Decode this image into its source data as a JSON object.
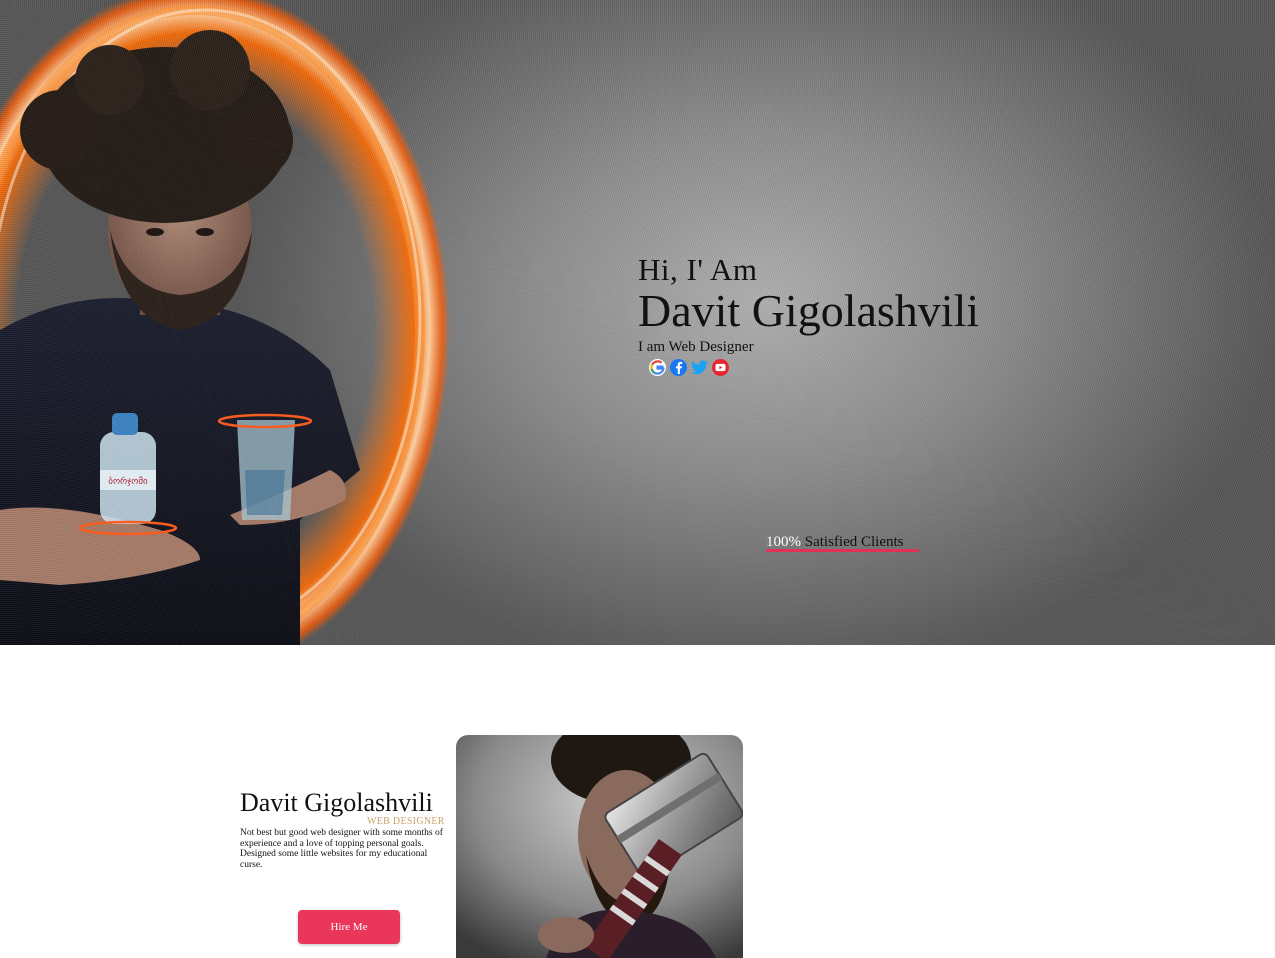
{
  "hero": {
    "greeting": "Hi, I' Am",
    "name": "Davit Gigolashvili",
    "role": "I am Web Designer",
    "socials": [
      {
        "icon": "google-icon",
        "color": "#ea4335"
      },
      {
        "icon": "facebook-icon",
        "color": "#1877f2"
      },
      {
        "icon": "twitter-icon",
        "color": "#1da1f2"
      },
      {
        "icon": "youtube-icon",
        "color": "#ff0000"
      }
    ],
    "stat": {
      "value": "100%",
      "label": "Satisfied Clients"
    },
    "bottle_label": "ბორჯომი"
  },
  "about": {
    "name": "Davit Gigolashvili",
    "title": "WEB DESIGNER",
    "description": "Not best but good web designer with some months of experience and a love of topping personal goals. Designed some little websites for my educational curse.",
    "hire_label": "Hire Me"
  },
  "colors": {
    "accent": "#e9365a",
    "title_gold": "#c9a26b",
    "hero_gray": "#8c8c8c"
  }
}
